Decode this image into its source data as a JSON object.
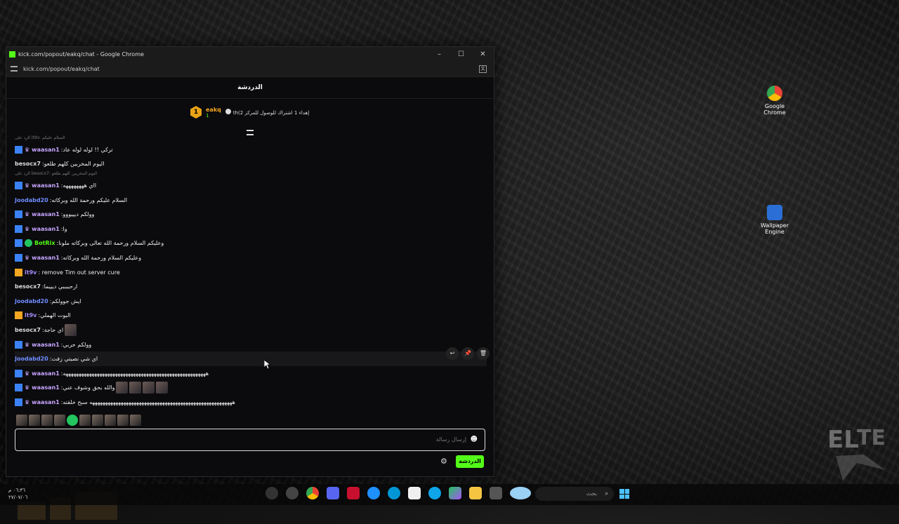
{
  "window": {
    "title": "kick.com/popout/eakq/chat - Google Chrome",
    "url": "kick.com/popout/eakq/chat",
    "controls": [
      "–",
      "☐",
      "✕"
    ]
  },
  "chat": {
    "header": "الدردشة",
    "pinned": {
      "user": "eakq",
      "count": "1",
      "text": "th(إهداء 1 اشتراك للوصول للمركز 2"
    },
    "messages": [
      {
        "reply": "الرد على it9v: السلام عليكم",
        "badge": "mod",
        "user": "waasan1",
        "color": "#c7a4ff",
        "text": ":تركي !! لوله لوله عاد"
      },
      {
        "badge": "none",
        "user": "besocx7",
        "color": "#dddddd",
        "text": ":اليوم المخربين كلهم طلعو"
      },
      {
        "reply": "الرد على besocx7: اليوم المخربين كلهم طلعو",
        "badge": "mod",
        "user": "waasan1",
        "color": "#c7a4ff",
        "text": ":ااي ههههههههه"
      },
      {
        "badge": "none",
        "user": "Joodabd20",
        "color": "#6f8cff",
        "text": ":السلام عليكم ورحمة الله وبركاته"
      },
      {
        "badge": "mod",
        "user": "waasan1",
        "color": "#c7a4ff",
        "text": ":وولكم ديييووو"
      },
      {
        "badge": "mod",
        "user": "waasan1",
        "color": "#c7a4ff",
        "text": ":وا"
      },
      {
        "badge": "bot",
        "user": "BotRix",
        "color": "#53fc18",
        "text": ":وعليكم السلام ورحمة الله تعالى وبركاته ملونا"
      },
      {
        "badge": "mod",
        "user": "waasan1",
        "color": "#c7a4ff",
        "text": ":وعليكم السلام ورحمة الله وبركاته"
      },
      {
        "badge": "vip",
        "user": "it9v",
        "color": "#a78bfa",
        "text": ": remove Tim out server cure"
      },
      {
        "badge": "none",
        "user": "besocx7",
        "color": "#dddddd",
        "text": ":ارحببببي ديييما"
      },
      {
        "badge": "none",
        "user": "Joodabd20",
        "color": "#6f8cff",
        "text": ":ايش جوولكم"
      },
      {
        "badge": "vip",
        "user": "it9v",
        "color": "#a78bfa",
        "text": ":البوت الهملي"
      },
      {
        "badge": "none",
        "user": "besocx7",
        "color": "#dddddd",
        "text": ":اي حاجة",
        "emotes": 1
      },
      {
        "badge": "mod",
        "user": "waasan1",
        "color": "#c7a4ff",
        "text": ":وولكم حربي"
      },
      {
        "badge": "none",
        "user": "Joodabd20",
        "color": "#6f8cff",
        "text": ":اي شي نصيتي زفت",
        "highlight": true
      },
      {
        "badge": "mod",
        "user": "waasan1",
        "color": "#c7a4ff",
        "text": ":هههههههههههههههههههههههههههههههههههههههههههههههههههههههه"
      },
      {
        "badge": "mod",
        "user": "waasan1",
        "color": "#c7a4ff",
        "text": ":والله بحق وشوف عني",
        "emotes": 4
      },
      {
        "badge": "mod",
        "user": "waasan1",
        "color": "#c7a4ff",
        "text": ":هههههههههههههههههههههههههههههههههههههههههههههههههههههههه سبح خلقته"
      }
    ],
    "input_placeholder": "إرسال رسالة",
    "send_label": "الدردشة"
  },
  "desktop": {
    "icons": [
      {
        "label": "Google Chrome",
        "color": "#4285f4"
      },
      {
        "label": "Wallpaper Engine",
        "color": "#2b6fd6"
      }
    ]
  },
  "taskbar": {
    "search_placeholder": "بحث",
    "clock_time": "٠٦:٣٦ م",
    "clock_date": "٢٧/٠٧/٠٦"
  }
}
